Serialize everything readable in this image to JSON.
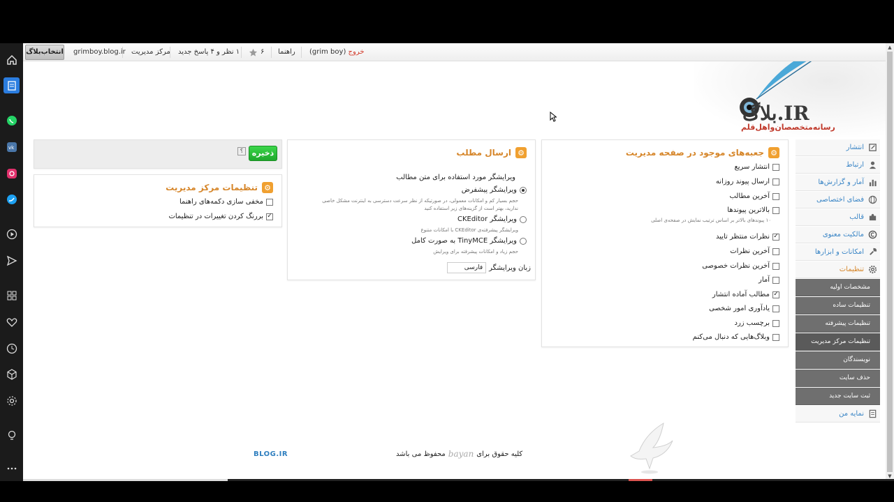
{
  "topbar": {
    "select_blog": "انتخاب‌بلاگ",
    "blog_domain": "grimboy.blog.ir",
    "admin_center": "مرکز مدیریت",
    "comments_status": "۱ نظر و ۴ پاسخ جدید",
    "stars_count": "۶",
    "help": "راهنما",
    "user": "(grim boy)",
    "logout": "خروج"
  },
  "logo": {
    "name": "بلاگ.IR",
    "tagline": "رسانه‌متخصصان‌و‌اهل‌قلم"
  },
  "save_panel": {
    "save_label": "ذخیره",
    "help_label": "؟"
  },
  "admin_settings": {
    "title": "تنظیمات مرکز مدیریت",
    "options": [
      {
        "label": "مخفی سازی دکمه‌های راهنما",
        "checked": false
      },
      {
        "label": "بررنگ کردن تغییرات در تنظیمات",
        "checked": true
      }
    ]
  },
  "post_settings": {
    "title": "ارسال مطلب",
    "editor_question": "ویرایشگر مورد استفاده برای متن مطالب",
    "editors": [
      {
        "label": "ویرایشگر پیشفرض",
        "selected": true,
        "hint": "حجم بسیار کم و امکانات معمولی، در صورتیکه از نظر سرعت دسترسی به اینترنت مشکل خاصی ندارید، بهتر است از گزینه‌های زیر استفاده کنید"
      },
      {
        "label": "ویرایشگر CKEditor",
        "selected": false,
        "hint": "ویرایشگر پیشرفته‌ی CKEditor با امکانات متنوع"
      },
      {
        "label": "ویرایشگر TinyMCE به صورت کامل",
        "selected": false,
        "hint": "حجم زیاد و امکانات پیشرفته برای ویرایش"
      }
    ],
    "language_label": "زبان ویرایشگر",
    "language_value": "فارسی"
  },
  "boxes": {
    "title": "جعبه‌های موجود در صفحه مدیریت",
    "items": [
      {
        "label": "انتشار سریع",
        "checked": false
      },
      {
        "label": "ارسال پیوند روزانه",
        "checked": false
      },
      {
        "label": "آخرین مطالب",
        "checked": false
      },
      {
        "label": "بالاترین پیوندها",
        "checked": false
      },
      {
        "label": "نظرات منتظر تایید",
        "checked": true
      },
      {
        "label": "آخرین نظرات",
        "checked": false
      },
      {
        "label": "آخرین نظرات خصوصی",
        "checked": false
      },
      {
        "label": "آمار",
        "checked": false
      },
      {
        "label": "مطالب آماده انتشار",
        "checked": true
      },
      {
        "label": "یادآوری امور شخصی",
        "checked": false
      },
      {
        "label": "برچسب زرد",
        "checked": false
      },
      {
        "label": "وبلاگ‌هایی که دنبال می‌کنم",
        "checked": false
      }
    ],
    "hint": "۱۰ پیوندهای بالاتر بر اساس ترتیب نمایش در صفحه‌ی اصلی"
  },
  "nav": {
    "items": [
      {
        "label": "انتشار",
        "icon": "publish-icon"
      },
      {
        "label": "ارتباط",
        "icon": "person-icon"
      },
      {
        "label": "آمار و گزارش‌ها",
        "icon": "chart-icon"
      },
      {
        "label": "فضای اختصاصی",
        "icon": "globe-icon"
      },
      {
        "label": "قالب",
        "icon": "puzzle-icon"
      },
      {
        "label": "مالکیت معنوی",
        "icon": "copyright-icon"
      },
      {
        "label": "امکانات و ابزارها",
        "icon": "wrench-icon"
      },
      {
        "label": "تنظیمات",
        "icon": "gear-icon"
      }
    ],
    "sub_items": [
      "مشخصات اولیه",
      "تنظیمات ساده",
      "تنظیمات پیشرفته",
      "تنظیمات مرکز مدیریت",
      "نویسندگان",
      "حذف سایت",
      "ثبت سایت جدید"
    ],
    "last_item": {
      "label": "نمایه من",
      "icon": "profile-icon"
    }
  },
  "footer": {
    "logo": "BLOG.IR",
    "copy_prefix": "کلیه حقوق برای",
    "brand": "bayan",
    "copy_suffix": "محفوظ می باشد"
  },
  "colors": {
    "accent_orange": "#d6862a",
    "link_blue": "#3b86c6",
    "save_green": "#20a82c",
    "logout_red": "#d23a2a"
  }
}
